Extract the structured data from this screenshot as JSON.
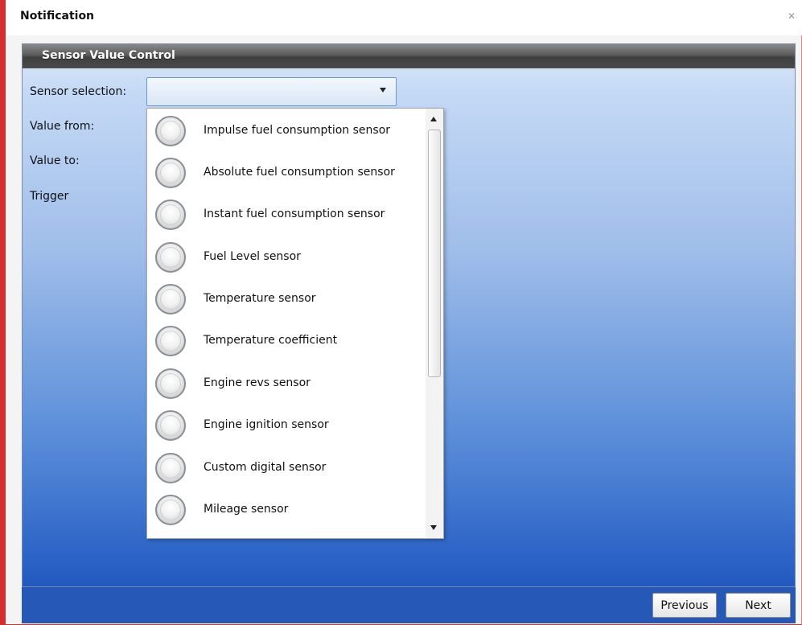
{
  "window": {
    "title": "Notification",
    "close_icon": "close-icon"
  },
  "panel": {
    "header": "Sensor Value Control"
  },
  "form": {
    "sensor_selection_label": "Sensor selection:",
    "value_from_label": "Value from:",
    "value_to_label": "Value to:",
    "trigger_label": "Trigger",
    "sensor_selection_value": ""
  },
  "dropdown": {
    "items": [
      {
        "label": "Impulse fuel consumption sensor",
        "selected": false
      },
      {
        "label": "Absolute fuel consumption sensor",
        "selected": false
      },
      {
        "label": "Instant fuel consumption sensor",
        "selected": false
      },
      {
        "label": "Fuel Level sensor",
        "selected": false
      },
      {
        "label": "Temperature sensor",
        "selected": false
      },
      {
        "label": "Temperature coefficient",
        "selected": false
      },
      {
        "label": "Engine revs sensor",
        "selected": false
      },
      {
        "label": "Engine ignition sensor",
        "selected": false
      },
      {
        "label": "Custom digital sensor",
        "selected": false
      },
      {
        "label": "Mileage sensor",
        "selected": false
      }
    ]
  },
  "footer": {
    "previous_label": "Previous",
    "next_label": "Next"
  },
  "colors": {
    "accent": "#d32f2f",
    "panel_bottom": "#2158be",
    "panel_top": "#dfe9f8",
    "header_dark": "#3f3f3f"
  }
}
